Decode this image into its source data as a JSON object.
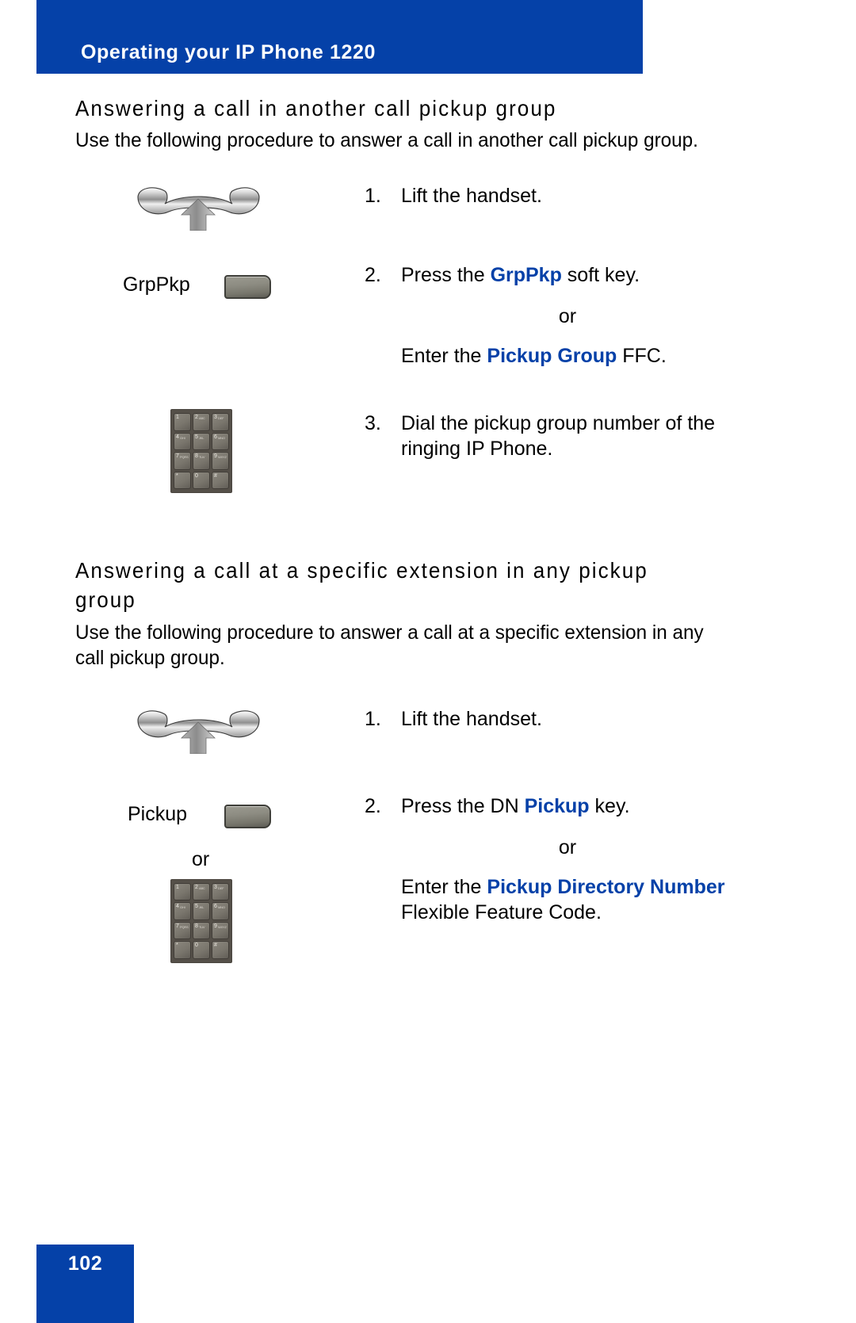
{
  "header": {
    "title": "Operating your IP Phone 1220",
    "bar_color": "#0541A8"
  },
  "footer": {
    "page_number": "102",
    "box_color": "#0541A8"
  },
  "accent_color": "#0541A8",
  "sections": [
    {
      "heading": "Answering a call in another call pickup group",
      "intro": "Use the following procedure to answer a call in another call pickup group.",
      "steps": [
        {
          "number": "1.",
          "text": "Lift the handset.",
          "icon": "handset-lift-icon"
        },
        {
          "number": "2.",
          "text_prefix": "Press the ",
          "text_highlight": "GrpPkp",
          "text_suffix": " soft key.",
          "or": "or",
          "alt_prefix": "Enter the ",
          "alt_highlight": "Pickup Group",
          "alt_suffix": " FFC.",
          "key_label": "GrpPkp",
          "icon": "softkey-button-icon"
        },
        {
          "number": "3.",
          "text": "Dial the pickup group number of the ringing IP Phone.",
          "icon": "dialpad-icon"
        }
      ]
    },
    {
      "heading": "Answering a call at a specific extension in any pickup group",
      "intro": "Use the following procedure to answer a call at a specific extension in any call pickup group.",
      "steps": [
        {
          "number": "1.",
          "text": "Lift the handset.",
          "icon": "handset-lift-icon"
        },
        {
          "number": "2.",
          "text_prefix": "Press the DN ",
          "text_highlight": "Pickup",
          "text_suffix": " key.",
          "or": "or",
          "alt_prefix": "Enter the ",
          "alt_highlight": "Pickup Directory Number",
          "alt_line2": "Flexible Feature Code.",
          "key_label": "Pickup",
          "gutter_or": "or",
          "icon": "softkey-button-icon",
          "icon2": "dialpad-icon"
        }
      ]
    }
  ],
  "keypad": {
    "keys": [
      {
        "digit": "1",
        "letters": ""
      },
      {
        "digit": "2",
        "letters": "ABC"
      },
      {
        "digit": "3",
        "letters": "DEF"
      },
      {
        "digit": "4",
        "letters": "GHI"
      },
      {
        "digit": "5",
        "letters": "JKL"
      },
      {
        "digit": "6",
        "letters": "MNO"
      },
      {
        "digit": "7",
        "letters": "PQRS"
      },
      {
        "digit": "8",
        "letters": "TUV"
      },
      {
        "digit": "9",
        "letters": "WXYZ"
      },
      {
        "digit": "*",
        "letters": ""
      },
      {
        "digit": "0",
        "letters": ""
      },
      {
        "digit": "#",
        "letters": ""
      }
    ]
  }
}
